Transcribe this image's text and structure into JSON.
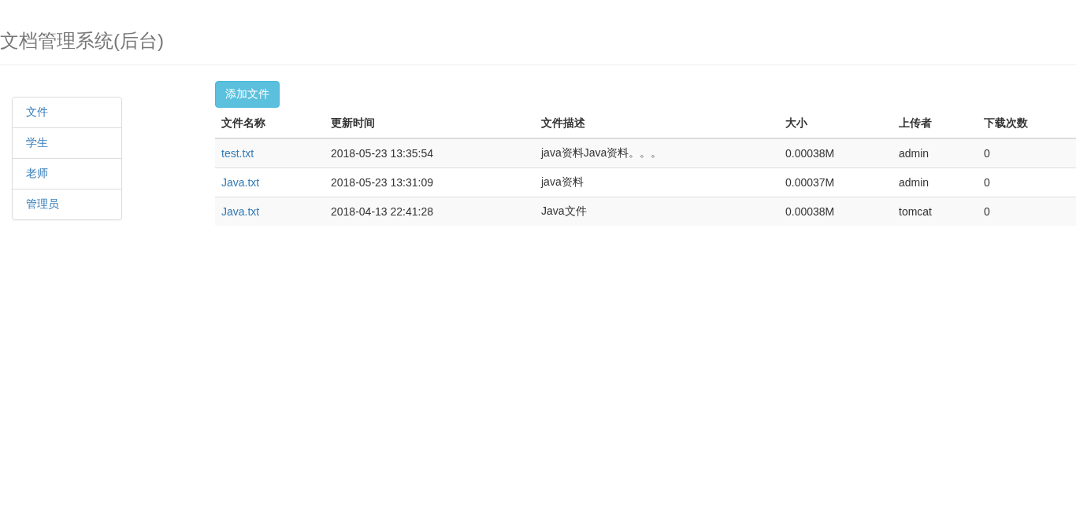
{
  "header": {
    "title": "文档管理系统(后台)"
  },
  "sidebar": {
    "items": [
      {
        "label": "文件"
      },
      {
        "label": "学生"
      },
      {
        "label": "老师"
      },
      {
        "label": "管理员"
      }
    ]
  },
  "toolbar": {
    "add_button": "添加文件"
  },
  "table": {
    "columns": [
      "文件名称",
      "更新时间",
      "文件描述",
      "大小",
      "上传者",
      "下载次数"
    ],
    "rows": [
      {
        "cells": [
          "test.txt",
          "2018-05-23 13:35:54",
          "java资料Java资料。。。",
          "0.00038M",
          "admin",
          "0"
        ]
      },
      {
        "cells": [
          "Java.txt",
          "2018-05-23 13:31:09",
          "java资料",
          "0.00037M",
          "admin",
          "0"
        ]
      },
      {
        "cells": [
          "Java.txt",
          "2018-04-13 22:41:28",
          "Java文件",
          "0.00038M",
          "tomcat",
          "0"
        ]
      }
    ]
  }
}
